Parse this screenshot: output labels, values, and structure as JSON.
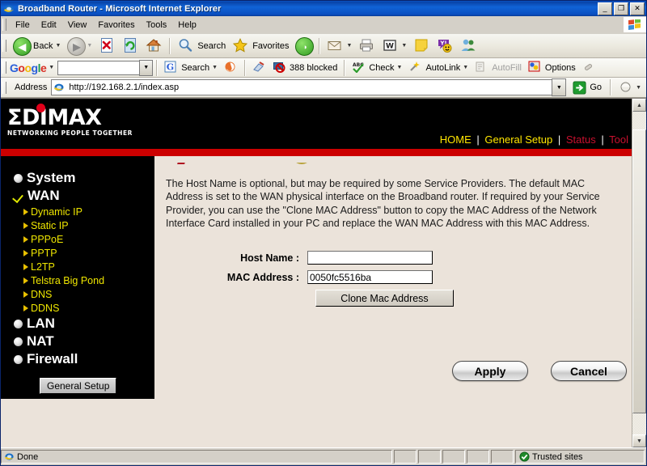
{
  "window": {
    "title": "Broadband Router - Microsoft Internet Explorer",
    "icon": "ie-icon",
    "minimize": "_",
    "restore": "❐",
    "close": "✕"
  },
  "menubar": {
    "items": [
      {
        "label": "File",
        "accel": "F"
      },
      {
        "label": "Edit",
        "accel": "E"
      },
      {
        "label": "View",
        "accel": "V"
      },
      {
        "label": "Favorites",
        "accel": "a"
      },
      {
        "label": "Tools",
        "accel": "T"
      },
      {
        "label": "Help",
        "accel": "H"
      }
    ]
  },
  "toolbar": {
    "back_label": "Back",
    "back_icon": "back-arrow-icon",
    "forward_icon": "forward-arrow-icon",
    "stop_icon": "stop-icon",
    "refresh_icon": "refresh-icon",
    "home_icon": "home-icon",
    "search_label": "Search",
    "search_icon": "magnifier-icon",
    "favorites_label": "Favorites",
    "favorites_icon": "star-icon",
    "media_icon": "media-icon",
    "mail_icon": "mail-icon",
    "print_icon": "printer-icon",
    "edit_word_icon": "word-edit-icon",
    "notes_icon": "notes-icon",
    "messenger_icon": "yahoo-messenger-icon",
    "people_icon": "msn-messenger-icon"
  },
  "google_toolbar": {
    "logo": "Google",
    "logo_letters": [
      "G",
      "o",
      "o",
      "g",
      "l",
      "e"
    ],
    "search_value": "",
    "search_label": "Search",
    "search_icon": "google-g-icon",
    "popup_icon": "popup-blocker-icon",
    "blocked_label": "388 blocked",
    "highlight_icon": "highlight-icon",
    "check_label": "Check",
    "check_icon": "spellcheck-icon",
    "autolink_label": "AutoLink",
    "autolink_icon": "wand-icon",
    "autofill_label": "AutoFill",
    "autofill_icon": "autofill-icon",
    "options_label": "Options",
    "options_icon": "options-icon",
    "eraser_icon": "eraser-icon"
  },
  "address_bar": {
    "label": "Address",
    "url": "http://192.168.2.1/index.asp",
    "favicon": "page-icon",
    "go_label": "Go",
    "go_icon": "go-arrow-icon",
    "links_label": "",
    "links_icon": "links-icon"
  },
  "page": {
    "brand": {
      "logo_text": "ΣDIMAX",
      "tagline": "NETWORKING PEOPLE TOGETHER",
      "accent_red": "#cc0000",
      "dot_color": "#e2001a"
    },
    "topnav": {
      "items": [
        {
          "label": "HOME",
          "state": "active"
        },
        {
          "label": "General Setup",
          "state": "active"
        },
        {
          "label": "Status",
          "state": "inactive"
        },
        {
          "label": "Tool",
          "state": "inactive"
        }
      ],
      "separator": "|",
      "active_color": "#ffe600",
      "inactive_color": "#c8102e"
    },
    "sidebar": {
      "top_items": [
        {
          "label": "System",
          "marker": "bullet-icon",
          "selected": false
        },
        {
          "label": "WAN",
          "marker": "check-icon",
          "selected": true
        }
      ],
      "sub_items": [
        {
          "label": "Dynamic IP",
          "marker": "arrow-icon"
        },
        {
          "label": "Static IP",
          "marker": "arrow-icon"
        },
        {
          "label": "PPPoE",
          "marker": "arrow-icon"
        },
        {
          "label": "PPTP",
          "marker": "arrow-icon"
        },
        {
          "label": "L2TP",
          "marker": "arrow-icon"
        },
        {
          "label": "Telstra Big Pond",
          "marker": "arrow-icon"
        },
        {
          "label": "DNS",
          "marker": "arrow-icon"
        },
        {
          "label": "DDNS",
          "marker": "arrow-icon"
        }
      ],
      "bottom_items": [
        {
          "label": "LAN",
          "marker": "bullet-icon"
        },
        {
          "label": "NAT",
          "marker": "bullet-icon"
        },
        {
          "label": "Firewall",
          "marker": "bullet-icon"
        }
      ],
      "button_label": "General Setup"
    },
    "content": {
      "description": "The Host Name is optional, but may be required by some Service Providers. The default MAC Address is set to the WAN physical interface on the Broadband router. If required by your Service Provider, you can use the \"Clone MAC Address\" button to copy the MAC Address of the Network Interface Card installed in your PC and replace the WAN MAC Address with this MAC Address.",
      "fields": [
        {
          "label": "Host Name :",
          "value": "",
          "name": "host-name"
        },
        {
          "label": "MAC Address :",
          "value": "0050fc5516ba",
          "name": "mac-address"
        }
      ],
      "clone_button": "Clone Mac Address",
      "apply_button": "Apply",
      "cancel_button": "Cancel",
      "background": "#ebe3da"
    }
  },
  "scrollbar": {
    "up_arrow": "▲",
    "down_arrow": "▼"
  },
  "statusbar": {
    "status_text": "Done",
    "status_icon": "ie-page-icon",
    "zone_label": "Trusted sites",
    "zone_icon": "trusted-sites-icon"
  }
}
